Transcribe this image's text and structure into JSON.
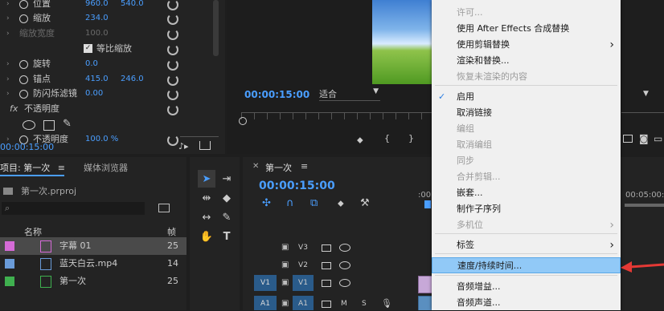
{
  "effect_controls": {
    "rows": [
      {
        "label": "位置",
        "v1": "960.0",
        "v2": "540.0"
      },
      {
        "label": "缩放",
        "v1": "234.0",
        "v2": ""
      },
      {
        "label": "缩放宽度",
        "v1": "100.0",
        "v2": ""
      },
      {
        "label": "等比缩放",
        "v1": "",
        "v2": ""
      },
      {
        "label": "旋转",
        "v1": "0.0",
        "v2": ""
      },
      {
        "label": "锚点",
        "v1": "415.0",
        "v2": "246.0"
      },
      {
        "label": "防闪烁滤镜",
        "v1": "0.00",
        "v2": ""
      },
      {
        "label": "不透明度",
        "v1": "",
        "v2": ""
      },
      {
        "label": "不透明度",
        "v1": "100.0 %",
        "v2": ""
      }
    ],
    "fx_label": "fx",
    "timecode": "00:00:15:00"
  },
  "program_monitor": {
    "timecode": "00:00:15:00",
    "fit": "适合"
  },
  "project_panel": {
    "tabs": [
      "项目: 第一次",
      "媒体浏览器"
    ],
    "project_file": "第一次.prproj",
    "name_header": "名称",
    "rate_header": "帧",
    "items": [
      {
        "name": "字幕 01",
        "color": "#d56bd7",
        "rate": "25",
        "selected": true
      },
      {
        "name": "蓝天白云.mp4",
        "color": "#6a9bd8",
        "rate": "14",
        "selected": false
      },
      {
        "name": "第一次",
        "color": "#3fb04f",
        "rate": "25",
        "selected": false
      }
    ]
  },
  "timeline": {
    "tab": "第一次",
    "timecode": "00:00:15:00",
    "ruler": [
      ":00:00",
      "00:05:00:00"
    ],
    "tracks": [
      {
        "name": "V3",
        "src": ""
      },
      {
        "name": "V2",
        "src": ""
      },
      {
        "name": "V1",
        "src": "V1"
      },
      {
        "name": "A1",
        "src": "A1",
        "m": "M",
        "s": "S"
      }
    ]
  },
  "context_menu": {
    "items": [
      {
        "label": "许可...",
        "disabled": true,
        "arrow": false,
        "checked": false,
        "sep_before": false
      },
      {
        "label": "使用 After Effects 合成替换",
        "disabled": false,
        "arrow": false,
        "checked": false,
        "sep_before": false
      },
      {
        "label": "使用剪辑替换",
        "disabled": false,
        "arrow": true,
        "checked": false,
        "sep_before": false
      },
      {
        "label": "渲染和替换...",
        "disabled": false,
        "arrow": false,
        "checked": false,
        "sep_before": false
      },
      {
        "label": "恢复未渲染的内容",
        "disabled": true,
        "arrow": false,
        "checked": false,
        "sep_before": false
      },
      {
        "label": "启用",
        "disabled": false,
        "arrow": false,
        "checked": true,
        "sep_before": true
      },
      {
        "label": "取消链接",
        "disabled": false,
        "arrow": false,
        "checked": false,
        "sep_before": false
      },
      {
        "label": "编组",
        "disabled": true,
        "arrow": false,
        "checked": false,
        "sep_before": false
      },
      {
        "label": "取消编组",
        "disabled": true,
        "arrow": false,
        "checked": false,
        "sep_before": false
      },
      {
        "label": "同步",
        "disabled": true,
        "arrow": false,
        "checked": false,
        "sep_before": false
      },
      {
        "label": "合并剪辑...",
        "disabled": true,
        "arrow": false,
        "checked": false,
        "sep_before": false
      },
      {
        "label": "嵌套...",
        "disabled": false,
        "arrow": false,
        "checked": false,
        "sep_before": false
      },
      {
        "label": "制作子序列",
        "disabled": false,
        "arrow": false,
        "checked": false,
        "sep_before": false
      },
      {
        "label": "多机位",
        "disabled": true,
        "arrow": true,
        "checked": false,
        "sep_before": false
      },
      {
        "label": "标签",
        "disabled": false,
        "arrow": true,
        "checked": false,
        "sep_before": true
      },
      {
        "label": "速度/持续时间...",
        "disabled": false,
        "arrow": false,
        "checked": false,
        "sep_before": true,
        "highlight": true
      },
      {
        "label": "音频增益...",
        "disabled": false,
        "arrow": false,
        "checked": false,
        "sep_before": true
      },
      {
        "label": "音频声道...",
        "disabled": false,
        "arrow": false,
        "checked": false,
        "sep_before": false
      }
    ]
  }
}
